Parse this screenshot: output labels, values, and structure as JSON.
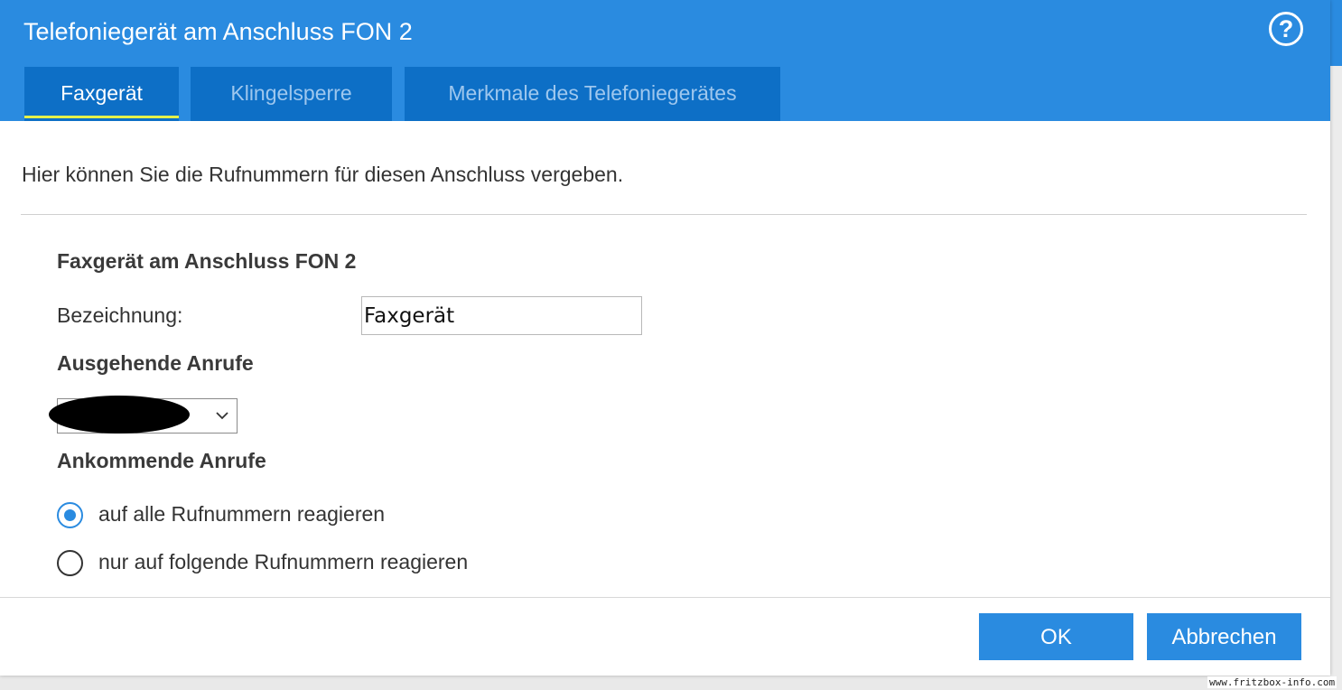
{
  "dialog": {
    "title": "Telefoniegerät am Anschluss FON 2",
    "help_symbol": "?"
  },
  "tabs": [
    {
      "label": "Faxgerät",
      "active": true
    },
    {
      "label": "Klingelsperre",
      "active": false
    },
    {
      "label": "Merkmale des Telefoniegerätes",
      "active": false
    }
  ],
  "intro_text": "Hier können Sie die Rufnummern für diesen Anschluss vergeben.",
  "section_device": {
    "heading": "Faxgerät am Anschluss FON 2",
    "name_label": "Bezeichnung:",
    "name_value": "Faxgerät"
  },
  "outgoing": {
    "heading": "Ausgehende Anrufe",
    "selected_value_redacted": true
  },
  "incoming": {
    "heading": "Ankommende Anrufe",
    "options": [
      {
        "label": "auf alle Rufnummern reagieren",
        "checked": true
      },
      {
        "label": "nur auf folgende Rufnummern reagieren",
        "checked": false
      }
    ]
  },
  "buttons": {
    "ok": "OK",
    "cancel": "Abbrechen"
  },
  "watermark": "www.fritzbox-info.com",
  "colors": {
    "header_blue": "#2a8be0",
    "tab_blue": "#0d6fc6",
    "active_underline": "#e3f04a"
  }
}
